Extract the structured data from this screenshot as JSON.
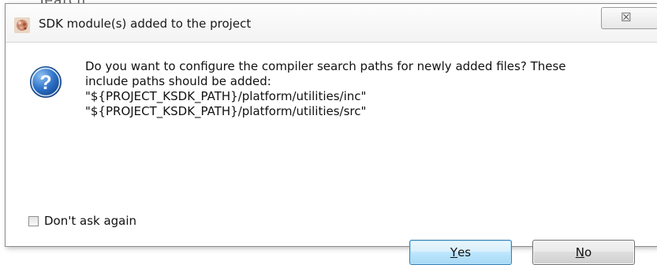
{
  "background": {
    "partial_text": "Tearch"
  },
  "dialog": {
    "title": "SDK module(s) added to the project",
    "close_symbol": "☒",
    "icons": {
      "app": "eclipse-app-icon",
      "close": "close-icon",
      "question": "question-mark-icon"
    },
    "question_glyph": "?",
    "message_lines": [
      "Do you want to configure the compiler search paths for newly added files? These",
      "include paths should be added:",
      "\"${PROJECT_KSDK_PATH}/platform/utilities/inc\"",
      "\"${PROJECT_KSDK_PATH}/platform/utilities/src\""
    ],
    "checkbox": {
      "label": "Don't ask again",
      "checked": false
    },
    "buttons": {
      "yes": {
        "mnemonic": "Y",
        "rest": "es"
      },
      "no": {
        "mnemonic": "N",
        "rest": "o"
      }
    }
  },
  "colors": {
    "dialog_background": "#f0f0f0",
    "content_background": "#ffffff",
    "default_button_border": "#3c7fb1",
    "question_icon_blue": "#1f5fb4"
  }
}
